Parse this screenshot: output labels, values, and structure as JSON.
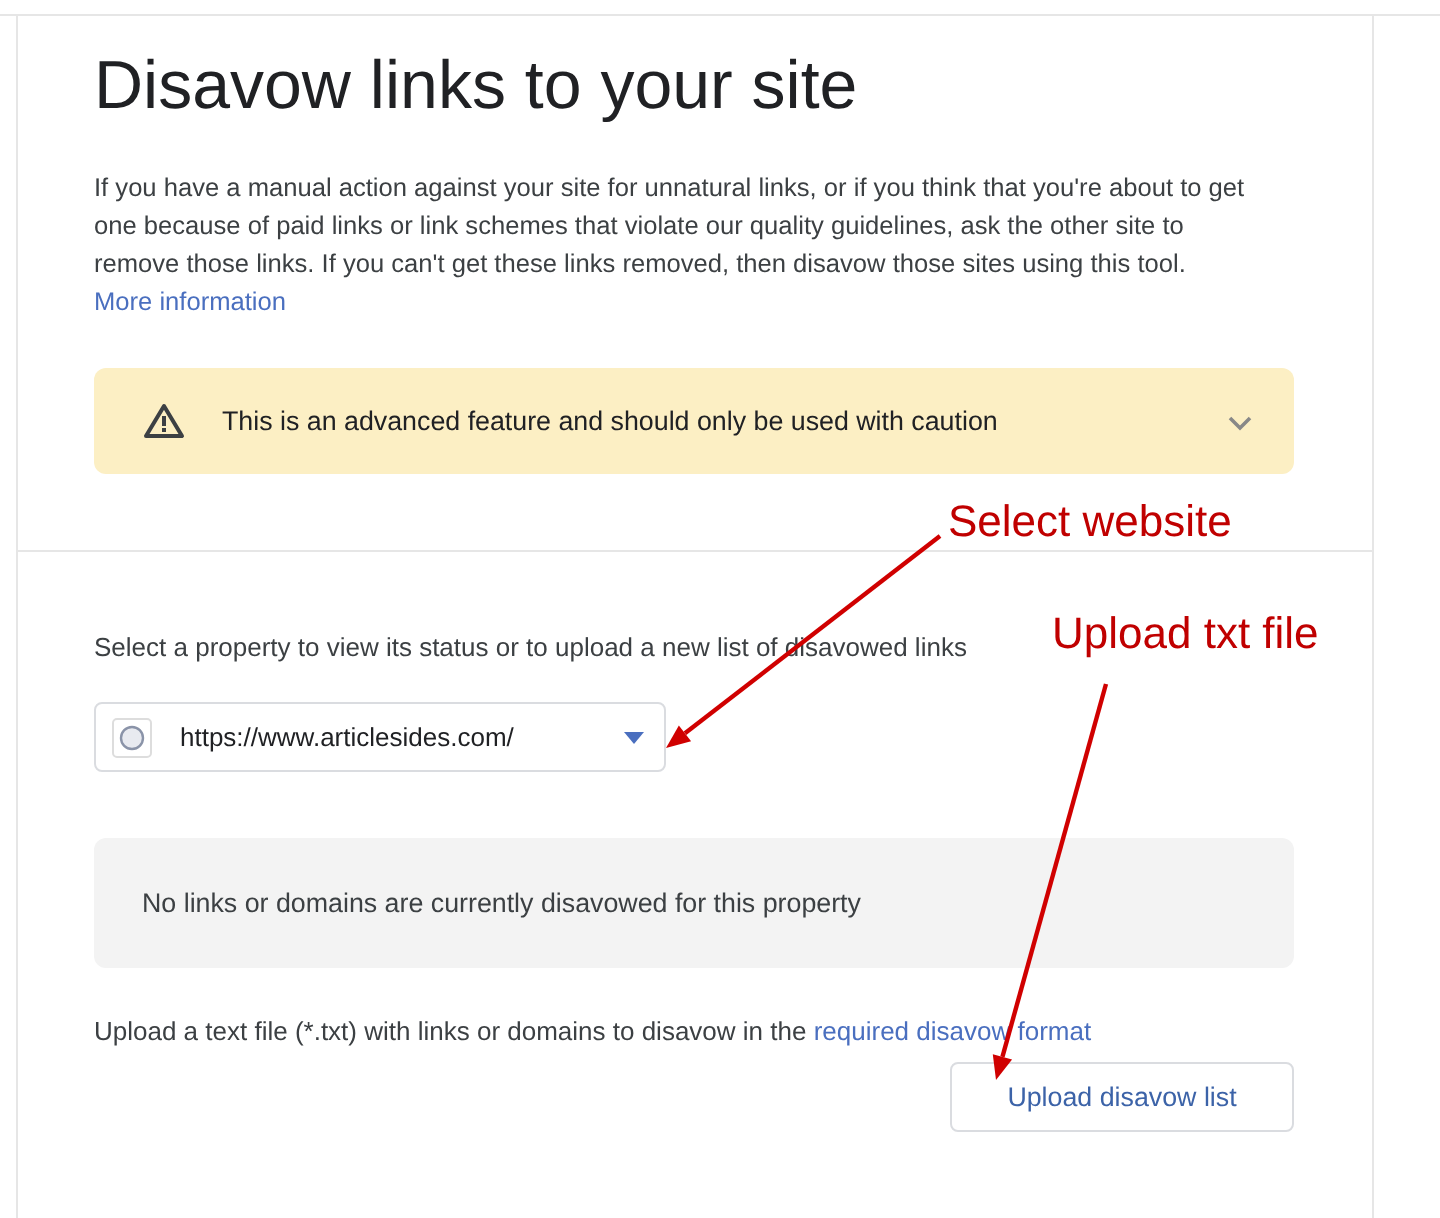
{
  "title": "Disavow links to your site",
  "intro": {
    "text": "If you have a manual action against your site for unnatural links, or if you think that you're about to get one because of paid links or link schemes that violate our quality guidelines, ask the other site to remove those links. If you can't get these links removed, then disavow those sites using this tool.",
    "link": "More information"
  },
  "warning": {
    "text": "This is an advanced feature and should only be used with caution",
    "expanded": false
  },
  "property_select": {
    "label": "Select a property to view its status or to upload a new list of disavowed links",
    "value": "https://www.articlesides.com/"
  },
  "status_message": "No links or domains are currently disavowed for this property",
  "upload": {
    "text": "Upload a text file (*.txt) with links or domains to disavow in the",
    "link": "required disavow format",
    "button": "Upload disavow list"
  },
  "annotations": [
    {
      "text": "Select website"
    },
    {
      "text": "Upload txt file"
    }
  ]
}
